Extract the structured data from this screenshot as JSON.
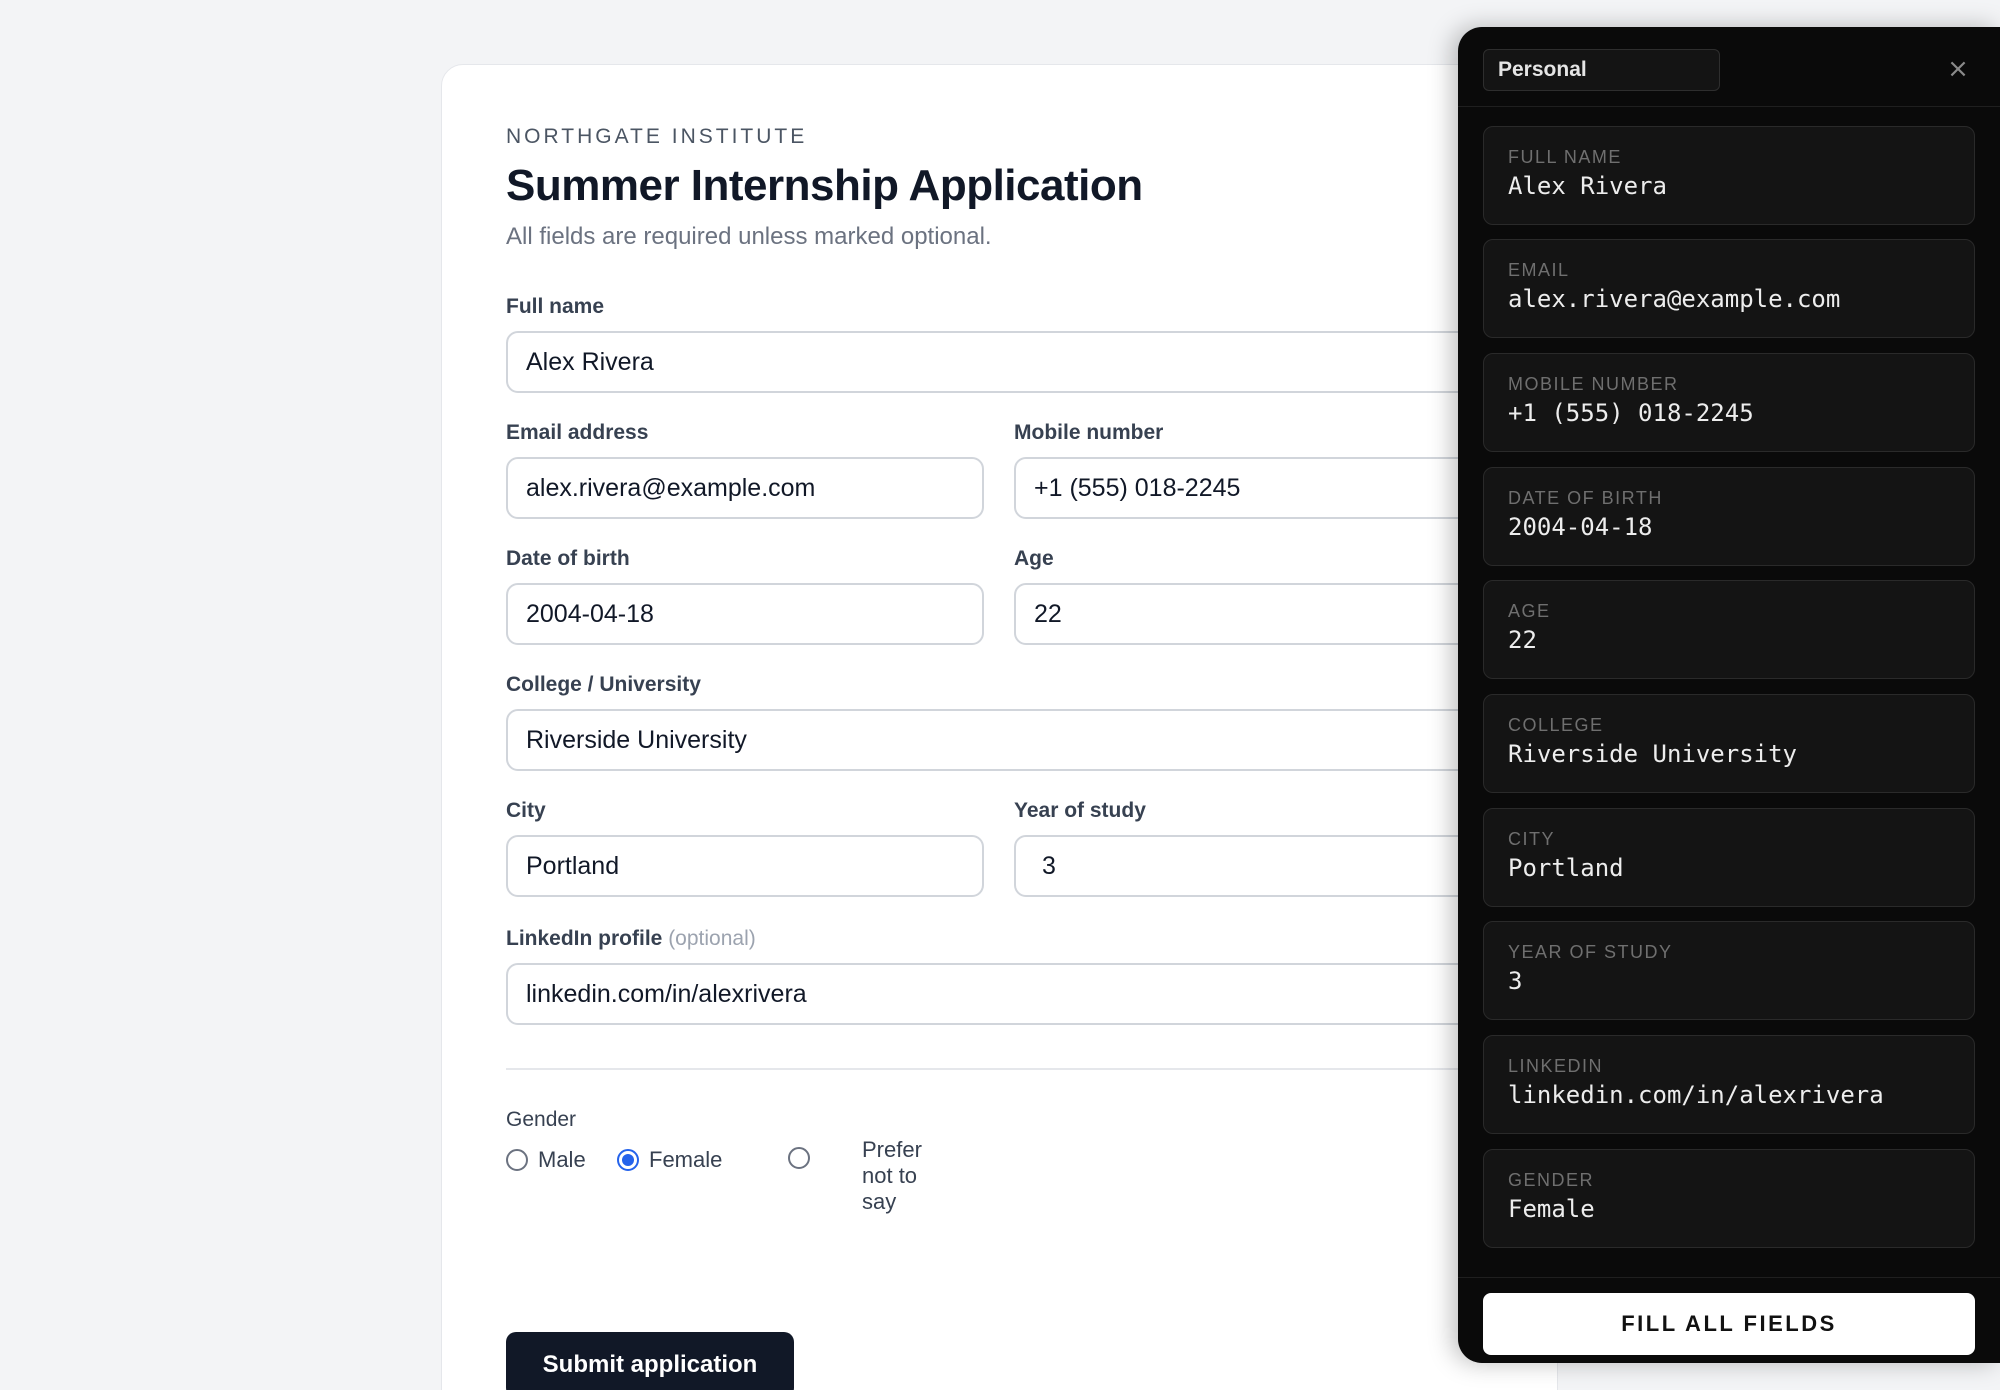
{
  "form": {
    "eyebrow": "NORTHGATE INSTITUTE",
    "title": "Summer Internship Application",
    "subtitle": "All fields are required unless marked optional.",
    "fields": {
      "full_name": {
        "label": "Full name",
        "value": "Alex Rivera"
      },
      "email": {
        "label": "Email address",
        "value": "alex.rivera@example.com"
      },
      "mobile": {
        "label": "Mobile number",
        "value": "+1 (555) 018-2245"
      },
      "dob": {
        "label": "Date of birth",
        "value": "2004-04-18"
      },
      "age": {
        "label": "Age",
        "value": "22"
      },
      "college": {
        "label": "College / University",
        "value": "Riverside University"
      },
      "city": {
        "label": "City",
        "value": "Portland"
      },
      "year": {
        "label": "Year of study",
        "value": "3"
      },
      "linkedin": {
        "label": "LinkedIn profile",
        "optional": "(optional)",
        "value": "linkedin.com/in/alexrivera"
      }
    },
    "gender": {
      "label": "Gender",
      "options": [
        "Male",
        "Female",
        "Prefer not to say"
      ],
      "selected": "Female"
    },
    "submit_label": "Submit application"
  },
  "panel": {
    "profile": "Personal",
    "close_glyph": "×",
    "entries": [
      {
        "label": "FULL NAME",
        "value": "Alex Rivera"
      },
      {
        "label": "EMAIL",
        "value": "alex.rivera@example.com"
      },
      {
        "label": "MOBILE NUMBER",
        "value": "+1 (555) 018-2245"
      },
      {
        "label": "DATE OF BIRTH",
        "value": "2004-04-18"
      },
      {
        "label": "AGE",
        "value": "22"
      },
      {
        "label": "COLLEGE",
        "value": "Riverside University"
      },
      {
        "label": "CITY",
        "value": "Portland"
      },
      {
        "label": "YEAR OF STUDY",
        "value": "3"
      },
      {
        "label": "LINKEDIN",
        "value": "linkedin.com/in/alexrivera"
      },
      {
        "label": "GENDER",
        "value": "Female"
      }
    ],
    "fill_label": "FILL ALL FIELDS"
  },
  "colors": {
    "page_bg": "#f3f4f6",
    "primary_button": "#111827",
    "radio_accent": "#2563eb",
    "panel_bg": "#0a0a0a"
  }
}
